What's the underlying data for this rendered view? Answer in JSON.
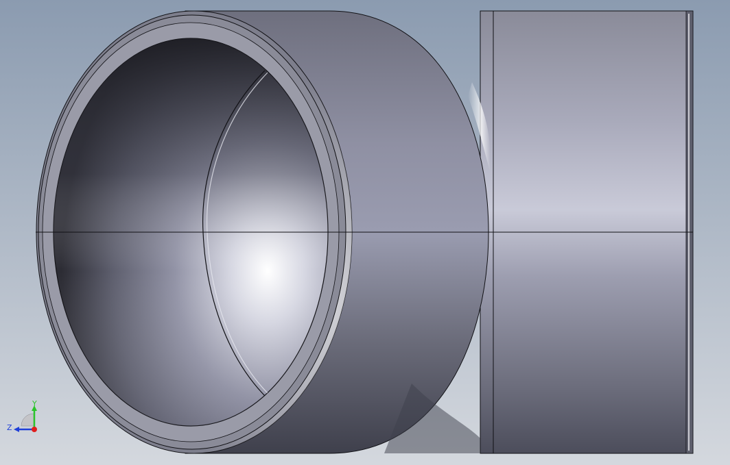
{
  "viewport": {
    "background_top": "#8b9bb0",
    "background_bottom": "#d4d8de"
  },
  "model": {
    "body_colors": [
      "#6a6b79",
      "#9a9cb0",
      "#c9cad8",
      "#55566a"
    ],
    "edge_color": "#101014",
    "highlight_color": "#ffffff"
  },
  "triad": {
    "y_label": "Y",
    "z_label": "Z",
    "y_color": "#2bc42b",
    "z_color": "#1f3fd8",
    "x_color": "#e01e1e"
  }
}
